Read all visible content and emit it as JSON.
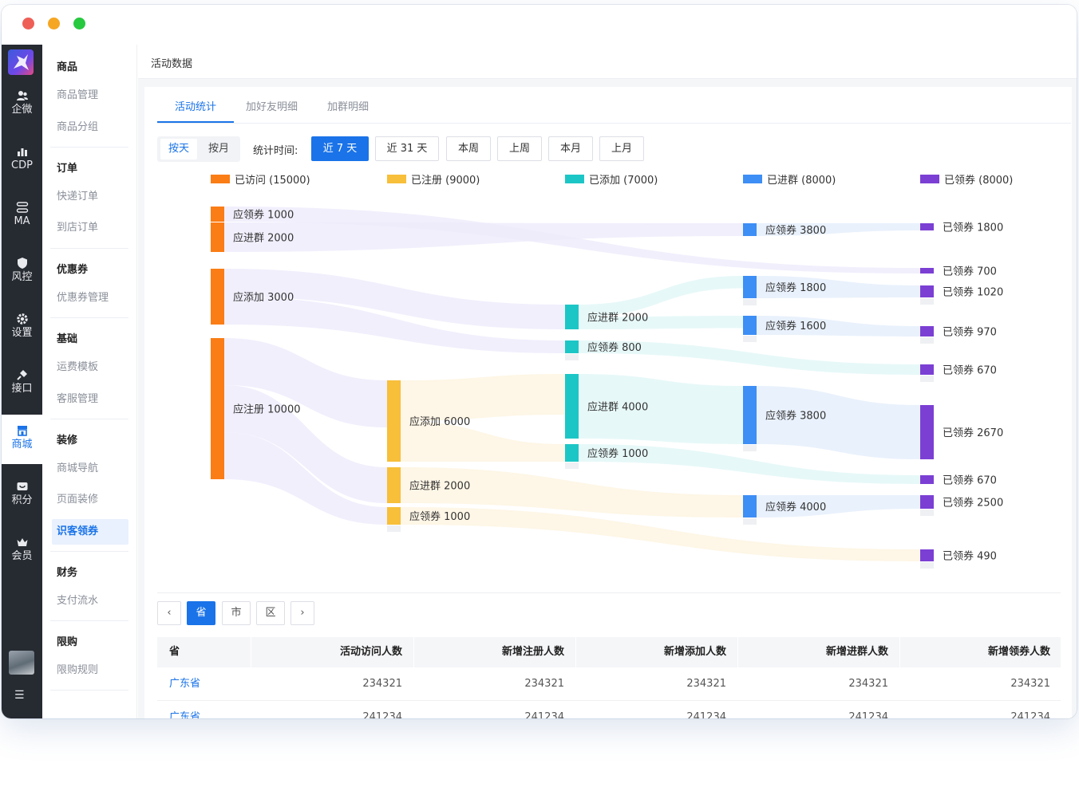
{
  "rail": {
    "items": [
      {
        "label": "企微",
        "icon": "users-icon"
      },
      {
        "label": "CDP",
        "icon": "bar-chart-icon"
      },
      {
        "label": "MA",
        "icon": "flow-icon"
      },
      {
        "label": "风控",
        "icon": "shield-icon"
      },
      {
        "label": "设置",
        "icon": "gear-icon"
      },
      {
        "label": "接口",
        "icon": "plug-icon"
      },
      {
        "label": "商城",
        "icon": "store-icon"
      },
      {
        "label": "积分",
        "icon": "points-icon"
      },
      {
        "label": "会员",
        "icon": "crown-icon"
      }
    ],
    "menu_toggle": "☰"
  },
  "sidebar": {
    "groups": [
      {
        "title": "商品",
        "items": [
          "商品管理",
          "商品分组"
        ]
      },
      {
        "title": "订单",
        "items": [
          "快递订单",
          "到店订单"
        ]
      },
      {
        "title": "优惠券",
        "items": [
          "优惠券管理"
        ]
      },
      {
        "title": "基础",
        "items": [
          "运费模板",
          "客服管理"
        ]
      },
      {
        "title": "装修",
        "items": [
          "商城导航",
          "页面装修",
          "识客领券"
        ]
      },
      {
        "title": "财务",
        "items": [
          "支付流水"
        ]
      },
      {
        "title": "限购",
        "items": [
          "限购规则"
        ]
      }
    ]
  },
  "page": {
    "title": "活动数据"
  },
  "tabs": [
    "活动统计",
    "加好友明细",
    "加群明细"
  ],
  "toolbar": {
    "granularity": [
      "按天",
      "按月"
    ],
    "stat_label": "统计时间:",
    "ranges": [
      "近 7 天",
      "近 31 天",
      "本周",
      "上周",
      "本月",
      "上月"
    ]
  },
  "chart_data": {
    "type": "sankey",
    "legend": [
      {
        "label": "已访问 (15000)",
        "color": "#fa7d15"
      },
      {
        "label": "已注册 (9000)",
        "color": "#f7bf3a"
      },
      {
        "label": "已添加 (7000)",
        "color": "#1dc6c6"
      },
      {
        "label": "已进群 (8000)",
        "color": "#3d8ef5"
      },
      {
        "label": "已领券 (8000)",
        "color": "#7b3fd4"
      }
    ],
    "stages": [
      "已访问",
      "已注册",
      "已添加",
      "已进群",
      "已领券"
    ],
    "nodes": [
      {
        "id": "n1",
        "stage": 0,
        "label": "应领券 1000",
        "value": 1000
      },
      {
        "id": "n2",
        "stage": 0,
        "label": "应进群 2000",
        "value": 2000
      },
      {
        "id": "n3",
        "stage": 0,
        "label": "应添加 3000",
        "value": 3000
      },
      {
        "id": "n4",
        "stage": 0,
        "label": "应注册 10000",
        "value": 10000
      },
      {
        "id": "r1",
        "stage": 1,
        "label": "应添加 6000",
        "value": 6000
      },
      {
        "id": "r2",
        "stage": 1,
        "label": "应进群 2000",
        "value": 2000
      },
      {
        "id": "r3",
        "stage": 1,
        "label": "应领券 1000",
        "value": 1000
      },
      {
        "id": "a1",
        "stage": 2,
        "label": "应进群 2000",
        "value": 2000
      },
      {
        "id": "a2",
        "stage": 2,
        "label": "应领券 800",
        "value": 800
      },
      {
        "id": "a3",
        "stage": 2,
        "label": "应进群 4000",
        "value": 4000
      },
      {
        "id": "a4",
        "stage": 2,
        "label": "应领券 1000",
        "value": 1000
      },
      {
        "id": "g1",
        "stage": 3,
        "label": "应领券 3800",
        "value": 3800
      },
      {
        "id": "g2",
        "stage": 3,
        "label": "应领券 1800",
        "value": 1800
      },
      {
        "id": "g3",
        "stage": 3,
        "label": "应领券 1600",
        "value": 1600
      },
      {
        "id": "g4",
        "stage": 3,
        "label": "应领券 3800",
        "value": 3800
      },
      {
        "id": "g5",
        "stage": 3,
        "label": "应领券 4000",
        "value": 4000
      },
      {
        "id": "c1",
        "stage": 4,
        "label": "已领券 1800",
        "value": 1800
      },
      {
        "id": "c2",
        "stage": 4,
        "label": "已领券 700",
        "value": 700
      },
      {
        "id": "c3",
        "stage": 4,
        "label": "已领券 1020",
        "value": 1020
      },
      {
        "id": "c4",
        "stage": 4,
        "label": "已领券 970",
        "value": 970
      },
      {
        "id": "c5",
        "stage": 4,
        "label": "已领券 670",
        "value": 670
      },
      {
        "id": "c6",
        "stage": 4,
        "label": "已领券 2670",
        "value": 2670
      },
      {
        "id": "c7",
        "stage": 4,
        "label": "已领券 670",
        "value": 670
      },
      {
        "id": "c8",
        "stage": 4,
        "label": "已领券 2500",
        "value": 2500
      },
      {
        "id": "c9",
        "stage": 4,
        "label": "已领券 490",
        "value": 490
      }
    ],
    "links": [
      {
        "from": "n1",
        "to": "c2"
      },
      {
        "from": "n2",
        "to": "g1"
      },
      {
        "from": "n3",
        "to": "a1"
      },
      {
        "from": "n3",
        "to": "a2"
      },
      {
        "from": "n4",
        "to": "r1"
      },
      {
        "from": "n4",
        "to": "r2"
      },
      {
        "from": "n4",
        "to": "r3"
      },
      {
        "from": "r1",
        "to": "a3"
      },
      {
        "from": "r1",
        "to": "a4"
      },
      {
        "from": "r2",
        "to": "g5"
      },
      {
        "from": "r3",
        "to": "c9"
      },
      {
        "from": "a1",
        "to": "g2"
      },
      {
        "from": "a1",
        "to": "g3"
      },
      {
        "from": "a2",
        "to": "c5"
      },
      {
        "from": "a3",
        "to": "g4"
      },
      {
        "from": "a4",
        "to": "c7"
      },
      {
        "from": "g1",
        "to": "c1"
      },
      {
        "from": "g2",
        "to": "c3"
      },
      {
        "from": "g3",
        "to": "c4"
      },
      {
        "from": "g4",
        "to": "c6"
      },
      {
        "from": "g5",
        "to": "c8"
      }
    ]
  },
  "region": {
    "prev": "‹",
    "next": "›",
    "levels": [
      "省",
      "市",
      "区"
    ]
  },
  "table": {
    "columns": [
      "省",
      "活动访问人数",
      "新增注册人数",
      "新增添加人数",
      "新增进群人数",
      "新增领券人数"
    ],
    "rows": [
      [
        "广东省",
        "234321",
        "234321",
        "234321",
        "234321",
        "234321"
      ],
      [
        "广东省",
        "241234",
        "241234",
        "241234",
        "241234",
        "241234"
      ]
    ]
  }
}
